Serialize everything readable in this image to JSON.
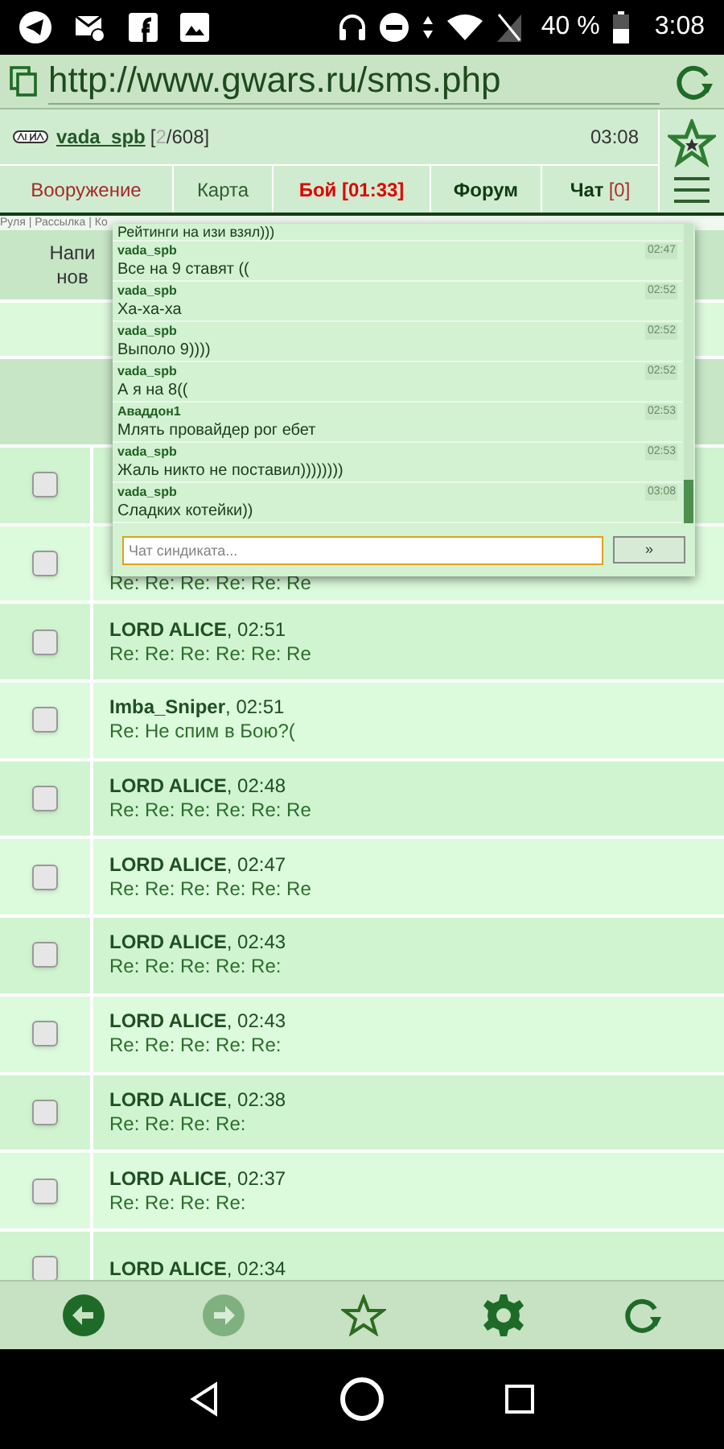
{
  "status_bar": {
    "battery": "40 %",
    "time": "3:08"
  },
  "browser": {
    "url": "http://www.gwars.ru/sms.php"
  },
  "header": {
    "user": "vada_spb",
    "counter_open": "[",
    "counter_current": "2",
    "counter_rest": "/608]",
    "time": "03:08"
  },
  "nav_tabs": [
    {
      "label": "Вооружение",
      "kind": "section"
    },
    {
      "label": "Карта",
      "kind": "plain"
    },
    {
      "label": "Бой [01:33]",
      "kind": "alert"
    },
    {
      "label": "Форум",
      "kind": "bold"
    },
    {
      "label": "Чат",
      "kind": "counter",
      "badge": "[0]"
    }
  ],
  "breadcrumb": "Руля | Рассылка | Ко",
  "inbox": {
    "heading_lines": [
      "Напи",
      "нов"
    ],
    "rows": [
      {
        "checked": false
      },
      {
        "checked": false,
        "body": "Re: Re: Re: Re: Re: Re"
      },
      {
        "checked": false,
        "header": "**LORD ALICE**, 02:51",
        "body": "Re: Re: Re: Re: Re: Re"
      },
      {
        "checked": false,
        "header": "**Imba_Sniper**, 02:51",
        "body": "Re: Не спим в Бою?("
      },
      {
        "checked": false,
        "header": "**LORD ALICE**, 02:48",
        "body": "Re: Re: Re: Re: Re: Re"
      },
      {
        "checked": false,
        "header": "**LORD ALICE**, 02:47",
        "body": "Re: Re: Re: Re: Re: Re"
      },
      {
        "checked": false,
        "header": "**LORD ALICE**, 02:43",
        "body": "Re: Re: Re: Re: Re:"
      },
      {
        "checked": false,
        "header": "**LORD ALICE**, 02:43",
        "body": "Re: Re: Re: Re: Re:"
      },
      {
        "checked": false,
        "header": "**LORD ALICE**, 02:38",
        "body": "Re: Re: Re: Re:"
      },
      {
        "checked": false,
        "header": "**LORD ALICE**, 02:37",
        "body": "Re: Re: Re: Re:"
      },
      {
        "checked": false,
        "header": "**LORD ALICE**, 02:34"
      }
    ]
  },
  "chat_popup": {
    "messages": [
      {
        "text": "Рейтинги на изи взял)))"
      },
      {
        "author": "vada_spb",
        "time": "02:47",
        "text": "Все на 9 ставят (("
      },
      {
        "author": "vada_spb",
        "time": "02:52",
        "text": "Ха-ха-ха"
      },
      {
        "author": "vada_spb",
        "time": "02:52",
        "text": "Выполо 9))))"
      },
      {
        "author": "vada_spb",
        "time": "02:52",
        "text": "А я на 8(("
      },
      {
        "author": "Аваддон1",
        "time": "02:53",
        "text": "Млять провайдер рог ебет"
      },
      {
        "author": "vada_spb",
        "time": "02:53",
        "text": "Жаль никто не поставил))))))))"
      },
      {
        "author": "vada_spb",
        "time": "03:08",
        "text": "Сладких котейки))"
      }
    ],
    "input": {
      "placeholder": "Чат синдиката..."
    },
    "send_button": "»"
  },
  "toolbar": [
    {
      "kind": "back",
      "disabled": false
    },
    {
      "kind": "forward",
      "disabled": true
    },
    {
      "kind": "bookmark"
    },
    {
      "kind": "settings"
    },
    {
      "kind": "reload"
    }
  ]
}
